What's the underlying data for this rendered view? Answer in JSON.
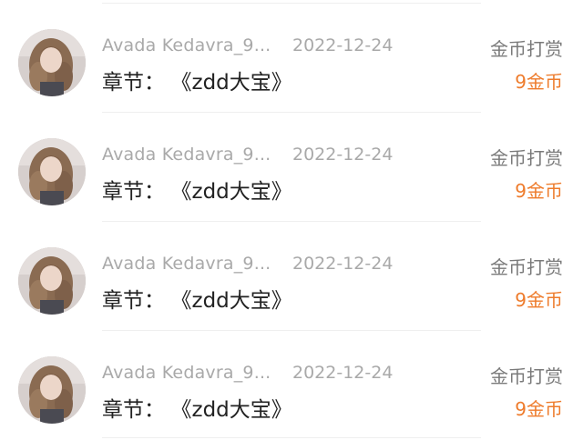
{
  "items": [
    {
      "user_name": "Avada Kedavra_9...",
      "date": "2022-12-24",
      "chapter_label": "章节：",
      "chapter_title": "《zdd大宝》",
      "reward_type": "金币打赏",
      "reward_amount": "9金币",
      "avatar_icon": "user-avatar-photo"
    },
    {
      "user_name": "Avada Kedavra_9...",
      "date": "2022-12-24",
      "chapter_label": "章节：",
      "chapter_title": "《zdd大宝》",
      "reward_type": "金币打赏",
      "reward_amount": "9金币",
      "avatar_icon": "user-avatar-photo"
    },
    {
      "user_name": "Avada Kedavra_9...",
      "date": "2022-12-24",
      "chapter_label": "章节：",
      "chapter_title": "《zdd大宝》",
      "reward_type": "金币打赏",
      "reward_amount": "9金币",
      "avatar_icon": "user-avatar-photo"
    },
    {
      "user_name": "Avada Kedavra_9...",
      "date": "2022-12-24",
      "chapter_label": "章节：",
      "chapter_title": "《zdd大宝》",
      "reward_type": "金币打赏",
      "reward_amount": "9金币",
      "avatar_icon": "user-avatar-photo"
    }
  ],
  "colors": {
    "accent_amount": "#ee7b2b",
    "muted_text": "#a9a9a9",
    "primary_text": "#222222"
  }
}
